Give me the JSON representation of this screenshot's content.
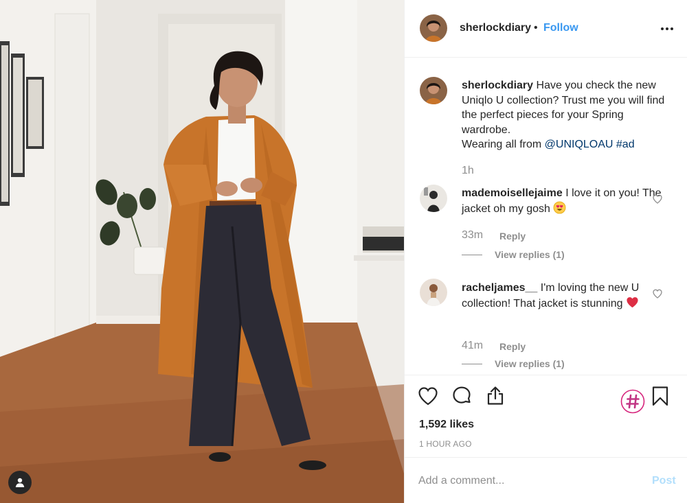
{
  "post": {
    "username": "sherlockdiary",
    "separator": "•",
    "follow_label": "Follow",
    "more_icon": "more-horizontal-icon",
    "user_tag_icon": "user-tag-icon"
  },
  "caption": {
    "username": "sherlockdiary",
    "text": "Have you check the new Uniqlo U collection? Trust me you will find the perfect pieces for your Spring wardrobe.",
    "line2_prefix": "Wearing all from ",
    "mention": "@UNIQLOAU",
    "hashtag": "#ad",
    "time": "1h"
  },
  "comments": [
    {
      "username": "mademoisellejaime",
      "text": "I love it on you! The jacket oh my gosh",
      "emoji": "heart-eyes-emoji",
      "time": "33m",
      "reply_label": "Reply",
      "view_replies": "View replies (1)"
    },
    {
      "username": "racheljames__",
      "text": "I'm loving the new U collection! That jacket is stunning",
      "emoji": "red-heart-emoji",
      "time": "41m",
      "reply_label": "Reply",
      "view_replies": "View replies (1)"
    }
  ],
  "actions": {
    "icons": [
      "heart-icon",
      "comment-icon",
      "share-icon",
      "hashtag-icon",
      "bookmark-icon"
    ],
    "likes": "1,592 likes",
    "time_ago": "1 HOUR AGO"
  },
  "add_comment": {
    "placeholder": "Add a comment...",
    "post_label": "Post"
  },
  "colors": {
    "link": "#3897f0",
    "post_disabled": "#b2dffc",
    "muted": "#8e8e8e",
    "text": "#262626",
    "coat": "#c8742a"
  }
}
